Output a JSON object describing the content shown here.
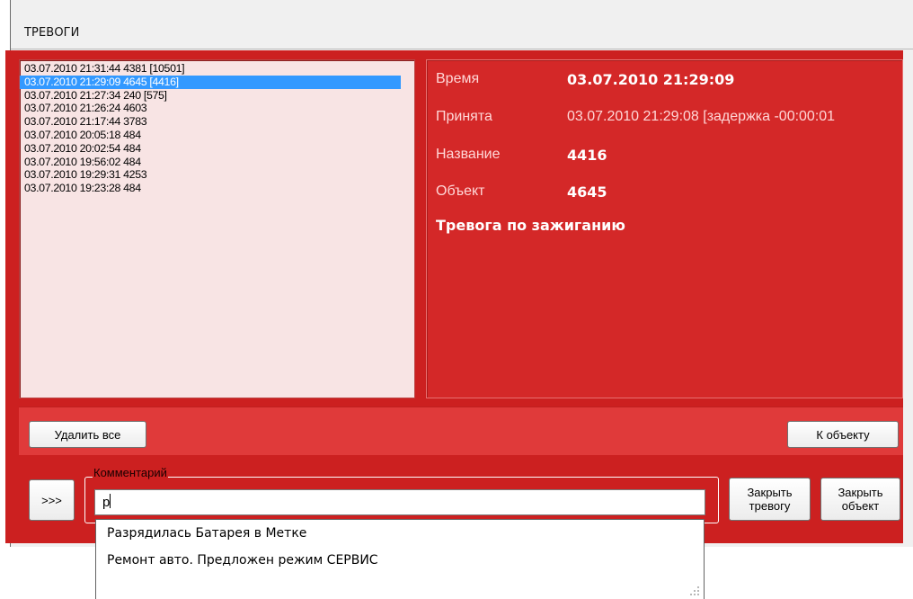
{
  "window": {
    "title": "ТРЕВОГИ"
  },
  "alarm_list": {
    "items": [
      {
        "label": "03.07.2010 21:31:44  4381 [10501]",
        "selected": false
      },
      {
        "label": "03.07.2010 21:29:09  4645 [4416]",
        "selected": true
      },
      {
        "label": "03.07.2010 21:27:34  240 [575]",
        "selected": false
      },
      {
        "label": "03.07.2010 21:26:24  4603",
        "selected": false
      },
      {
        "label": "03.07.2010 21:17:44  3783",
        "selected": false
      },
      {
        "label": "03.07.2010 20:05:18  484",
        "selected": false
      },
      {
        "label": "03.07.2010 20:02:54  484",
        "selected": false
      },
      {
        "label": "03.07.2010 19:56:02  484",
        "selected": false
      },
      {
        "label": "03.07.2010 19:29:31  4253",
        "selected": false
      },
      {
        "label": "03.07.2010 19:23:28  484",
        "selected": false
      }
    ]
  },
  "details": {
    "time_label": "Время",
    "time_value": "03.07.2010 21:29:09",
    "accepted_label": "Принята",
    "accepted_value": "03.07.2010 21:29:08 [задержка -00:00:01",
    "name_label": "Название",
    "name_value": "4416",
    "object_label": "Объект",
    "object_value": "4645",
    "event_text": "Тревога по зажиганию"
  },
  "buttons": {
    "delete_all": "Удалить все",
    "to_object": "К объекту",
    "expand": ">>>",
    "close_alarm": "Закрыть тревогу",
    "close_object": "Закрыть объект"
  },
  "comment": {
    "legend": "Комментарий",
    "value": "р",
    "suggestions": [
      "Разрядилась Батарея в Метке",
      "Ремонт авто. Предложен режим СЕРВИС"
    ]
  },
  "colors": {
    "panel_red": "#cc2020",
    "details_red": "#d42828",
    "button_bar_red": "#e03a3a",
    "list_bg": "#f8e4e4",
    "selection_blue": "#3399ff"
  }
}
